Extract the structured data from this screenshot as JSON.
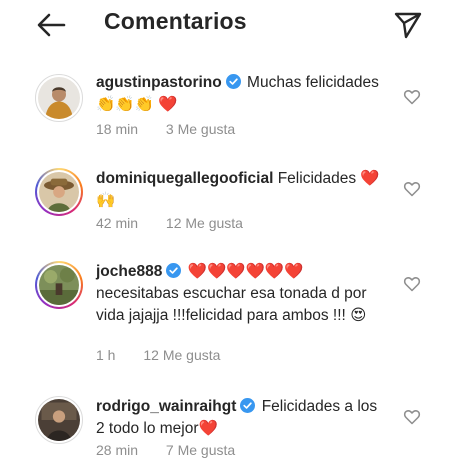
{
  "header": {
    "title": "Comentarios",
    "back_icon": "arrow-left-icon",
    "send_icon": "paper-plane-icon"
  },
  "colors": {
    "text": "#262626",
    "meta": "#8e8e8e",
    "verified_blue": "#3897f0"
  },
  "comments": [
    {
      "username": "agustinpastorino",
      "verified": true,
      "text": "Muchas felicidades 👏👏👏 ❤️",
      "time": "18 min",
      "likes": "3 Me gusta",
      "story_ring": false
    },
    {
      "username": "dominiquegallegooficial",
      "verified": false,
      "text": "Felicidades ❤️🙌",
      "time": "42 min",
      "likes": "12 Me gusta",
      "story_ring": true
    },
    {
      "username": "joche888",
      "verified": true,
      "text": "❤️❤️❤️❤️❤️❤️ necesitabas escuchar esa tonada d por vida  jajajja !!!felicidad para ambos !!! 😍",
      "time": "1 h",
      "likes": "12 Me gusta",
      "story_ring": true
    },
    {
      "username": "rodrigo_wainraihgt",
      "verified": true,
      "text": "Felicidades a los 2 todo lo mejor❤️",
      "time": "28 min",
      "likes": "7 Me gusta",
      "story_ring": false
    }
  ]
}
